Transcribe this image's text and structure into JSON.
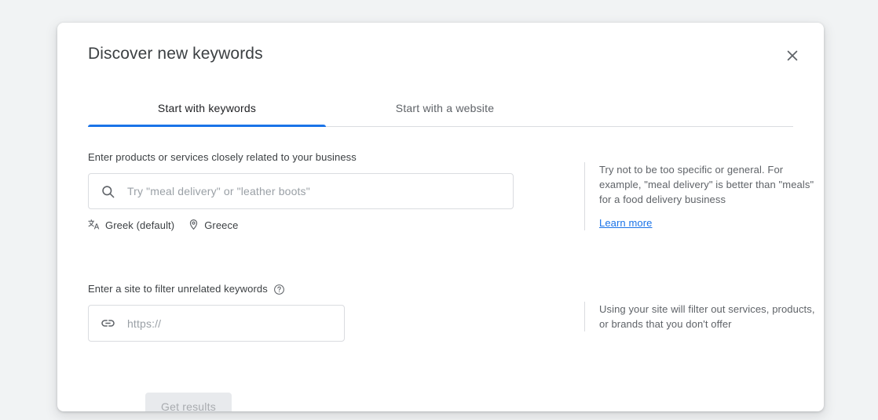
{
  "dialog": {
    "title": "Discover new keywords",
    "close_icon": "close-icon"
  },
  "tabs": [
    {
      "label": "Start with keywords",
      "active": true
    },
    {
      "label": "Start with a website",
      "active": false
    }
  ],
  "keywords_section": {
    "label": "Enter products or services closely related to your business",
    "search_icon": "search-icon",
    "input_value": "",
    "placeholder": "Try \"meal delivery\" or \"leather boots\"",
    "language": {
      "icon": "translate-icon",
      "label": "Greek (default)"
    },
    "location": {
      "icon": "location-pin-icon",
      "label": "Greece"
    },
    "help": {
      "text": "Try not to be too specific or general. For example, \"meal delivery\" is better than \"meals\" for a food delivery business",
      "link_label": "Learn more"
    }
  },
  "site_section": {
    "label": "Enter a site to filter unrelated keywords",
    "help_icon": "help-circle-icon",
    "link_icon": "link-icon",
    "input_value": "",
    "placeholder": "https://",
    "help": {
      "text": "Using your site will filter out services, products, or brands that you don't offer"
    }
  },
  "footer": {
    "get_results_label": "Get results",
    "get_results_disabled": true
  },
  "colors": {
    "accent": "#1a73e8",
    "page_background": "#f1f3f4",
    "card_background": "#ffffff",
    "text_primary": "#3c4043",
    "text_secondary": "#5f6368",
    "border": "#dadce0",
    "disabled_button_bg": "#e8eaed"
  }
}
